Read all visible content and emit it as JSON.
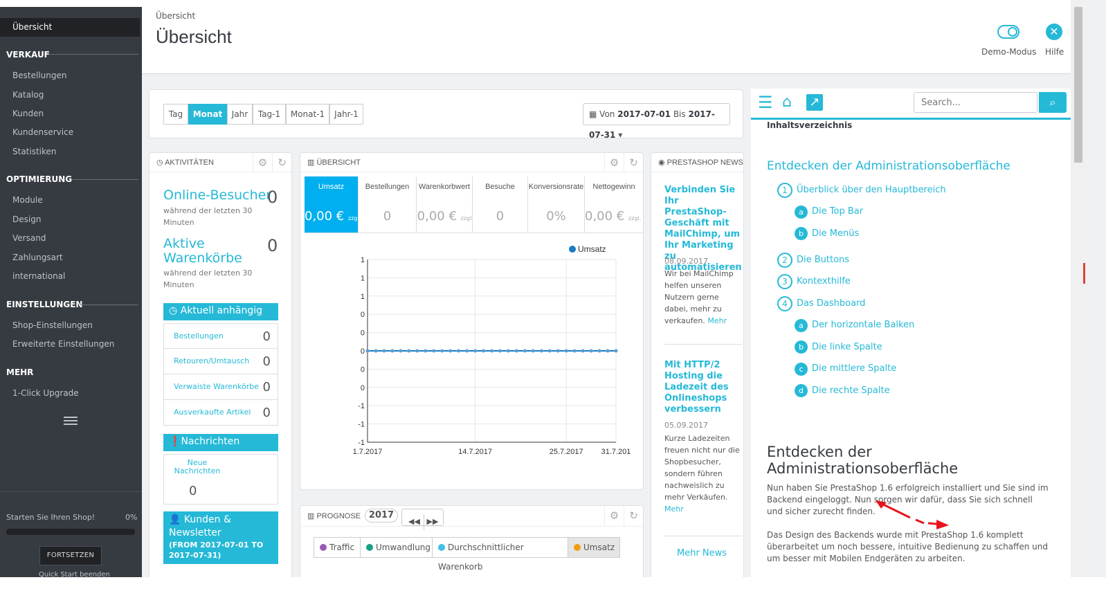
{
  "sidebar": {
    "active": "Übersicht",
    "sections": [
      {
        "title": "VERKAUF",
        "items": [
          "Bestellungen",
          "Katalog",
          "Kunden",
          "Kundenservice",
          "Statistiken"
        ]
      },
      {
        "title": "OPTIMIERUNG",
        "items": [
          "Module",
          "Design",
          "Versand",
          "Zahlungsart",
          "international"
        ]
      },
      {
        "title": "EINSTELLUNGEN",
        "items": [
          "Shop-Einstellungen",
          "Erweiterte Einstellungen"
        ]
      },
      {
        "title": "MEHR",
        "items": [
          "1-Click Upgrade"
        ]
      }
    ],
    "quickstart": {
      "label": "Starten Sie Ihren Shop!",
      "percent": "0%",
      "button": "FORTSETZEN",
      "end": "Quick Start beenden"
    }
  },
  "header": {
    "breadcrumb": "Übersicht",
    "title": "Übersicht",
    "demo_label": "Demo-Modus",
    "help_label": "Hilfe"
  },
  "period": {
    "buttons": [
      "Tag",
      "Monat",
      "Jahr",
      "Tag-1",
      "Monat-1",
      "Jahr-1"
    ],
    "active": "Monat",
    "date_from_label": "Von",
    "date_from": "2017-07-01",
    "date_to_label": "Bis",
    "date_to": "2017-07-31"
  },
  "activities": {
    "title": "AKTIVITÄTEN",
    "online_label": "Online-Besucher",
    "online_value": "0",
    "online_sub": "während der letzten 30 Minuten",
    "carts_label": "Aktive Warenkörbe",
    "carts_value": "0",
    "carts_sub": "während der letzten 30 Minuten",
    "pending_title": "Aktuell anhängig",
    "pending": [
      {
        "label": "Bestellungen",
        "value": "0"
      },
      {
        "label": "Retouren/Umtausch",
        "value": "0"
      },
      {
        "label": "Verwaiste Warenkörbe",
        "value": "0"
      },
      {
        "label": "Ausverkaufte Artikel",
        "value": "0"
      }
    ],
    "messages_title": "Nachrichten",
    "new_messages_label": "Neue Nachrichten",
    "new_messages_value": "0",
    "customers_title": "Kunden & Newsletter",
    "customers_range": "(FROM 2017-07-01 TO 2017-07-31)"
  },
  "overview": {
    "title": "ÜBERSICHT",
    "kpis": [
      {
        "label": "Umsatz",
        "value": "0,00 €",
        "suffix": "zzgl"
      },
      {
        "label": "Bestellungen",
        "value": "0",
        "suffix": ""
      },
      {
        "label": "Warenkorbwert",
        "value": "0,00 €",
        "suffix": "zzgl"
      },
      {
        "label": "Besuche",
        "value": "0",
        "suffix": ""
      },
      {
        "label": "Konversionsrate",
        "value": "0%",
        "suffix": ""
      },
      {
        "label": "Nettogewinn",
        "value": "0,00 €",
        "suffix": "zzgl. M"
      }
    ]
  },
  "chart_data": {
    "type": "line",
    "legend": "Umsatz",
    "legend_position": "top-right",
    "series_color": "#1a7cc0",
    "x_tick_labels": [
      "1.7.2017",
      "14.7.2017",
      "25.7.2017",
      "31.7.201"
    ],
    "y_tick_labels": [
      "1",
      "1",
      "1",
      "0",
      "0",
      "0",
      "0",
      "0",
      "-1",
      "-1",
      "-1"
    ],
    "x": [
      1,
      2,
      3,
      4,
      5,
      6,
      7,
      8,
      9,
      10,
      11,
      12,
      13,
      14,
      15,
      16,
      17,
      18,
      19,
      20,
      21,
      22,
      23,
      24,
      25,
      26,
      27,
      28,
      29,
      30,
      31
    ],
    "y": [
      0,
      0,
      0,
      0,
      0,
      0,
      0,
      0,
      0,
      0,
      0,
      0,
      0,
      0,
      0,
      0,
      0,
      0,
      0,
      0,
      0,
      0,
      0,
      0,
      0,
      0,
      0,
      0,
      0,
      0,
      0
    ],
    "ylim": [
      -1,
      1
    ],
    "grid": true
  },
  "forecast": {
    "title": "PROGNOSE",
    "year": "2017",
    "legend": [
      {
        "label": "Traffic",
        "color": "#9b59b6"
      },
      {
        "label": "Umwandlung",
        "color": "#16a085"
      },
      {
        "label": "Durchschnittlicher Warenkorb",
        "color": "#3ec1e5"
      },
      {
        "label": "Umsatz",
        "color": "#f39c12"
      }
    ]
  },
  "news": {
    "title": "PRESTASHOP NEWS",
    "items": [
      {
        "title": "Verbinden Sie Ihr PrestaShop-Geschäft mit MailChimp, um Ihr Marketing zu automatisieren",
        "date": "08.09.2017",
        "text": "Wir bei MailChimp helfen unseren Nutzern gerne dabei, mehr zu verkaufen.",
        "more": "Mehr"
      },
      {
        "title": "Mit HTTP/2 Hosting die Ladezeit des Onlineshops verbessern",
        "date": "05.09.2017",
        "text": "Kurze Ladezeiten freuen nicht nur die Shopbesucher, sondern führen nachweislich zu mehr Verkäufen.",
        "more": "Mehr"
      }
    ],
    "more_news": "Mehr News"
  },
  "help": {
    "search_placeholder": "Search...",
    "toc_label": "Inhaltsverzeichnis",
    "toc_title": "Entdecken der Administrationsoberfläche",
    "toc": [
      {
        "num": "1",
        "label": "Überblick über den Hauptbereich"
      },
      {
        "sub": "a",
        "label": "Die Top Bar"
      },
      {
        "sub": "b",
        "label": "Die Menüs"
      },
      {
        "num": "2",
        "label": "Die Buttons"
      },
      {
        "num": "3",
        "label": "Kontexthilfe"
      },
      {
        "num": "4",
        "label": "Das Dashboard"
      },
      {
        "sub": "a",
        "label": "Der horizontale Balken"
      },
      {
        "sub": "b",
        "label": "Die linke Spalte"
      },
      {
        "sub": "c",
        "label": "Die mittlere Spalte"
      },
      {
        "sub": "d",
        "label": "Die rechte Spalte"
      }
    ],
    "article_title": "Entdecken der Administrationsoberfläche",
    "para1": "Nun haben Sie PrestaShop 1.6 erfolgreich installiert und Sie sind im Backend eingeloggt. Nun sorgen wir dafür, dass Sie sich schnell und sicher zurecht finden.",
    "para2": "Das Design des Backends wurde mit PrestaShop 1.6 komplett überarbeitet um noch bessere, intuitive Bedienung zu schaffen und um besser mit Mobilen Endgeräten zu arbeiten."
  }
}
